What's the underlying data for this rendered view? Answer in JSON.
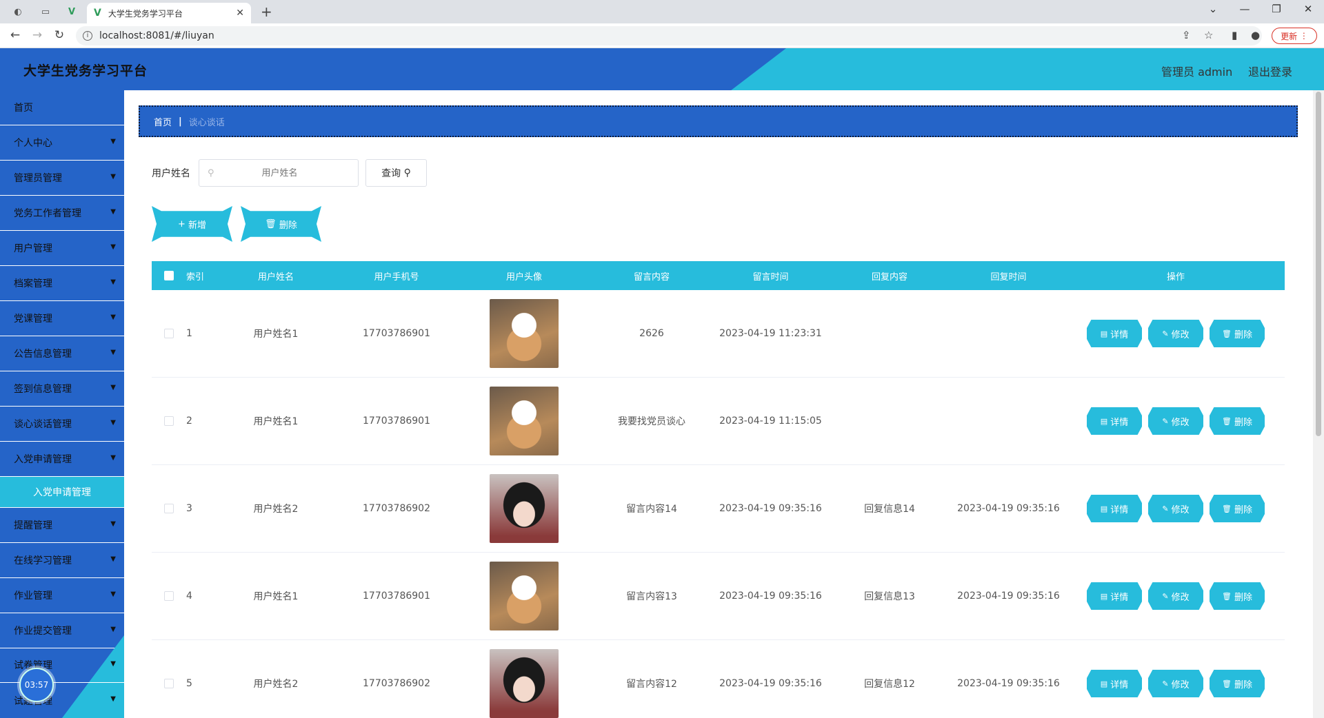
{
  "browser": {
    "tab_title": "大学生党务学习平台",
    "url": "localhost:8081/#/liuyan",
    "update_label": "更新"
  },
  "header": {
    "title": "大学生党务学习平台",
    "admin_label": "管理员 admin",
    "logout_label": "退出登录"
  },
  "sidebar": {
    "items": [
      {
        "label": "首页"
      },
      {
        "label": "个人中心"
      },
      {
        "label": "管理员管理"
      },
      {
        "label": "党务工作者管理"
      },
      {
        "label": "用户管理"
      },
      {
        "label": "档案管理"
      },
      {
        "label": "党课管理"
      },
      {
        "label": "公告信息管理"
      },
      {
        "label": "签到信息管理"
      },
      {
        "label": "谈心谈话管理"
      },
      {
        "label": "入党申请管理"
      },
      {
        "label": "提醒管理"
      },
      {
        "label": "在线学习管理"
      },
      {
        "label": "作业管理"
      },
      {
        "label": "作业提交管理"
      },
      {
        "label": "试卷管理"
      },
      {
        "label": "试题管理"
      }
    ],
    "sub_item": "入党申请管理",
    "timer": "03:57"
  },
  "breadcrumb": {
    "home": "首页",
    "current": "谈心谈话"
  },
  "search": {
    "label": "用户姓名",
    "placeholder": "用户姓名",
    "button": "查询"
  },
  "actions": {
    "add": "新增",
    "delete": "删除"
  },
  "table": {
    "headers": {
      "index": "索引",
      "name": "用户姓名",
      "phone": "用户手机号",
      "avatar": "用户头像",
      "message": "留言内容",
      "time": "留言时间",
      "reply": "回复内容",
      "reply_time": "回复时间",
      "ops": "操作"
    },
    "rows": [
      {
        "index": "1",
        "name": "用户姓名1",
        "phone": "17703786901",
        "message": "2626",
        "time": "2023-04-19 11:23:31",
        "reply": "",
        "reply_time": ""
      },
      {
        "index": "2",
        "name": "用户姓名1",
        "phone": "17703786901",
        "message": "我要找党员谈心",
        "time": "2023-04-19 11:15:05",
        "reply": "",
        "reply_time": ""
      },
      {
        "index": "3",
        "name": "用户姓名2",
        "phone": "17703786902",
        "message": "留言内容14",
        "time": "2023-04-19 09:35:16",
        "reply": "回复信息14",
        "reply_time": "2023-04-19 09:35:16"
      },
      {
        "index": "4",
        "name": "用户姓名1",
        "phone": "17703786901",
        "message": "留言内容13",
        "time": "2023-04-19 09:35:16",
        "reply": "回复信息13",
        "reply_time": "2023-04-19 09:35:16"
      },
      {
        "index": "5",
        "name": "用户姓名2",
        "phone": "17703786902",
        "message": "留言内容12",
        "time": "2023-04-19 09:35:16",
        "reply": "回复信息12",
        "reply_time": "2023-04-19 09:35:16"
      }
    ],
    "op_labels": {
      "detail": "详情",
      "edit": "修改",
      "delete": "删除"
    }
  }
}
